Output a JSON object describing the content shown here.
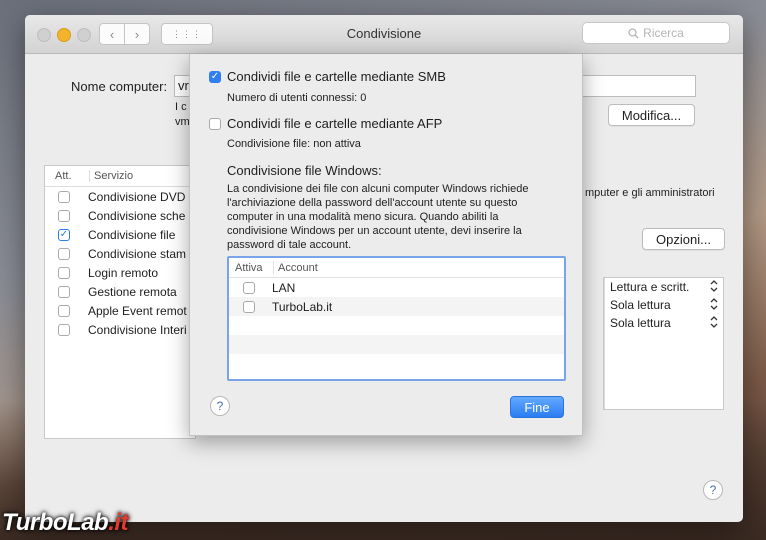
{
  "window": {
    "title": "Condivisione",
    "search_placeholder": "Ricerca",
    "nav_back": "‹",
    "nav_fwd": "›",
    "nav_grid": "⋮⋮⋮"
  },
  "background": {
    "computer_name_label": "Nome computer:",
    "computer_name_value": "vr",
    "info_line1": "I c",
    "info_line2": "vm",
    "modifica_button": "Modifica...",
    "opzioni_button": "Opzioni...",
    "side_note": "mputer e gli amministratori",
    "services_header_att": "Att.",
    "services_header_service": "Servizio",
    "services": [
      {
        "label": "Condivisione DVD",
        "checked": false
      },
      {
        "label": "Condivisione sche",
        "checked": false
      },
      {
        "label": "Condivisione file",
        "checked": true
      },
      {
        "label": "Condivisione stam",
        "checked": false
      },
      {
        "label": "Login remoto",
        "checked": false
      },
      {
        "label": "Gestione remota",
        "checked": false
      },
      {
        "label": "Apple Event remot",
        "checked": false
      },
      {
        "label": "Condivisione Interi",
        "checked": false
      }
    ],
    "permissions": [
      "Lettura e scritt.",
      "Sola lettura",
      "Sola lettura"
    ],
    "help": "?"
  },
  "sheet": {
    "smb_label": "Condividi file e cartelle mediante SMB",
    "smb_checked": true,
    "smb_users": "Numero di utenti connessi: 0",
    "afp_label": "Condividi file e cartelle mediante AFP",
    "afp_checked": false,
    "afp_status": "Condivisione file: non attiva",
    "windows_title": "Condivisione file Windows:",
    "windows_text": "La condivisione dei file con alcuni computer Windows richiede l'archiviazione della password dell'account utente su questo computer in una modalità meno sicura. Quando abiliti la condivisione Windows per un account utente, devi inserire la password di tale account.",
    "table_header_active": "Attiva",
    "table_header_account": "Account",
    "accounts": [
      {
        "name": "LAN",
        "active": false
      },
      {
        "name": "TurboLab.it",
        "active": false
      }
    ],
    "help": "?",
    "done_button": "Fine"
  },
  "watermark": {
    "part1": "TurboLab",
    "part2": ".it"
  },
  "colors": {
    "accent": "#2a7df2",
    "min_light": "#f4b32b"
  }
}
